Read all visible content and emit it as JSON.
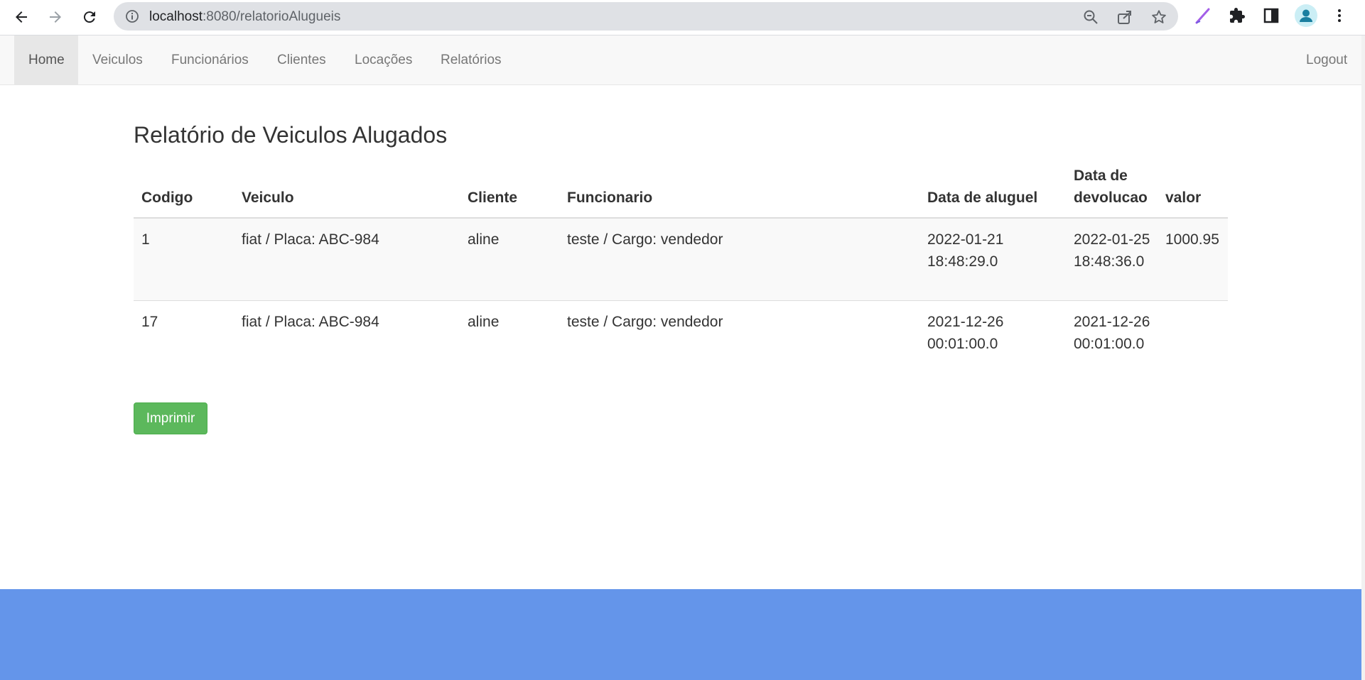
{
  "browser": {
    "url_host": "localhost",
    "url_rest": ":8080/relatorioAlugueis",
    "icons": [
      "back-arrow-icon",
      "forward-arrow-icon",
      "reload-icon",
      "info-icon",
      "zoom-out-icon",
      "share-icon",
      "star-icon",
      "pen-extension-icon",
      "puzzle-icon",
      "sidebar-icon",
      "profile-icon",
      "kebab-menu-icon"
    ]
  },
  "nav": {
    "items": [
      {
        "label": "Home"
      },
      {
        "label": "Veiculos"
      },
      {
        "label": "Funcionários"
      },
      {
        "label": "Clientes"
      },
      {
        "label": "Locações"
      },
      {
        "label": "Relatórios"
      }
    ],
    "logout": "Logout"
  },
  "page": {
    "title": "Relatório de Veiculos Alugados",
    "print_label": "Imprimir"
  },
  "table": {
    "headers": [
      "Codigo",
      "Veiculo",
      "Cliente",
      "Funcionario",
      "Data de aluguel",
      "Data de devolucao",
      "valor"
    ],
    "rows": [
      [
        "1",
        "fiat / Placa: ABC-984",
        "aline",
        "teste / Cargo: vendedor",
        "2022-01-21 18:48:29.0",
        "2022-01-25 18:48:36.0",
        "1000.95"
      ],
      [
        "17",
        "fiat / Placa: ABC-984",
        "aline",
        "teste / Cargo: vendedor",
        "2021-12-26 00:01:00.0",
        "2021-12-26 00:01:00.0",
        ""
      ]
    ]
  },
  "colors": {
    "footer": "#6495ea",
    "print_button": "#5cb85c",
    "navbar_bg": "#f8f8f8"
  }
}
